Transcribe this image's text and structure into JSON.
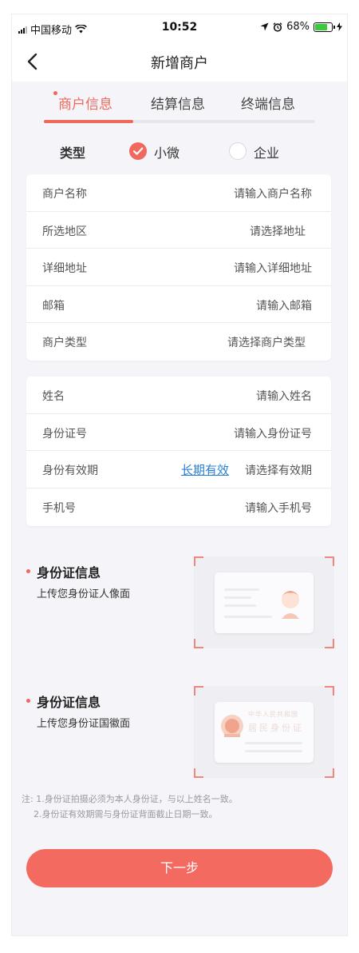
{
  "status_bar": {
    "carrier": "中国移动",
    "time": "10:52",
    "battery": "68%",
    "battery_level": 0.68
  },
  "nav": {
    "title": "新增商户"
  },
  "tabs": [
    {
      "label": "商户信息",
      "active": true
    },
    {
      "label": "结算信息",
      "active": false
    },
    {
      "label": "终端信息",
      "active": false
    }
  ],
  "progress": {
    "completed_fraction": 0.33
  },
  "type_row": {
    "label": "类型",
    "options": [
      {
        "label": "小微",
        "checked": true
      },
      {
        "label": "企业",
        "checked": false
      }
    ]
  },
  "merchant_fields": [
    {
      "label": "商户名称",
      "placeholder": "请输入商户名称"
    },
    {
      "label": "所选地区",
      "placeholder": "请选择地址"
    },
    {
      "label": "详细地址",
      "placeholder": "请输入详细地址"
    },
    {
      "label": "邮箱",
      "placeholder": "请输入邮箱"
    },
    {
      "label": "商户类型",
      "placeholder": "请选择商户类型"
    }
  ],
  "person_fields": [
    {
      "label": "姓名",
      "placeholder": "请输入姓名"
    },
    {
      "label": "身份证号",
      "placeholder": "请输入身份证号"
    },
    {
      "label": "身份有效期",
      "placeholder": "请选择有效期",
      "link": "长期有效"
    },
    {
      "label": "手机号",
      "placeholder": "请输入手机号"
    }
  ],
  "id_uploads": [
    {
      "title": "身份证信息",
      "subtitle": "上传您身份证人像面"
    },
    {
      "title": "身份证信息",
      "subtitle": "上传您身份证国徽面",
      "card_line1": "中华人民共和国",
      "card_line2": "居民身份证"
    }
  ],
  "notes": [
    "注: 1.身份证拍摄必须为本人身份证，与以上姓名一致。",
    "2.身份证有效期需与身份证背面截止日期一致。"
  ],
  "next_button": "下一步",
  "colors": {
    "accent": "#f0685e",
    "link": "#2a7fd4",
    "background": "#f5f4f8"
  }
}
